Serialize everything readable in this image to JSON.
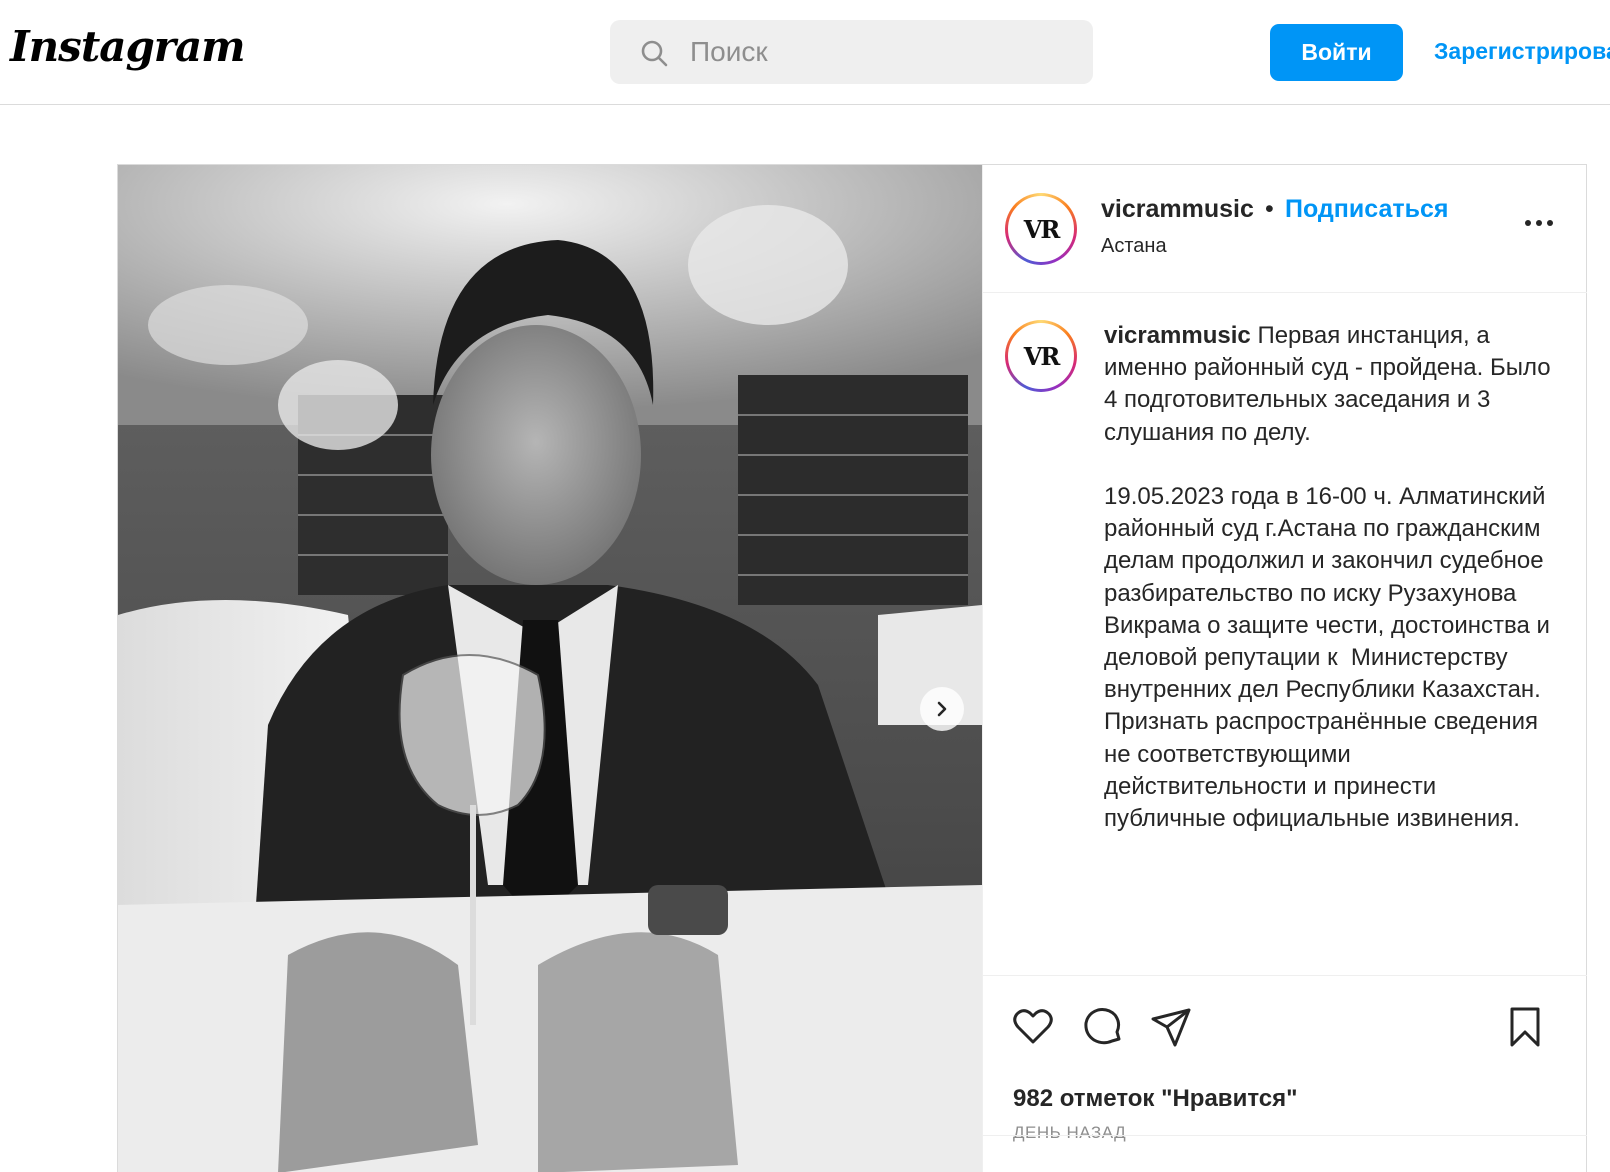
{
  "header": {
    "logo": "Instagram",
    "search_placeholder": "Поиск",
    "login_label": "Войти",
    "register_label": "Зарегистрироваться"
  },
  "post": {
    "username": "vicrammusic",
    "separator": "•",
    "follow_label": "Подписаться",
    "location": "Астана",
    "avatar_text": "VR",
    "caption": "Первая инстанция, а именно районный суд - пройдена. Было 4 подготовительных заседания и 3 слушания по делу.\n\n19.05.2023 года в 16-00 ч. Алматинский районный суд г.Астана по гражданским делам продолжил и закончил судебное разбирательство по иску Рузахунова Викрама о защите чести, достоинства и деловой репутации к  Министерству внутренних дел Республики Казахстан. Признать распространённые сведения не соответствующими действительности и принести публичные официальные извинения.",
    "likes": "982 отметок \"Нравится\"",
    "time": "ДЕНЬ НАЗАД"
  },
  "icons": {
    "search": "search-icon",
    "more": "more-options-icon",
    "next": "chevron-right-icon",
    "like": "heart-icon",
    "comment": "comment-icon",
    "share": "paper-plane-icon",
    "save": "bookmark-icon"
  },
  "colors": {
    "accent": "#0095f6",
    "border": "#dbdbdb",
    "muted": "#8e8e8e"
  }
}
